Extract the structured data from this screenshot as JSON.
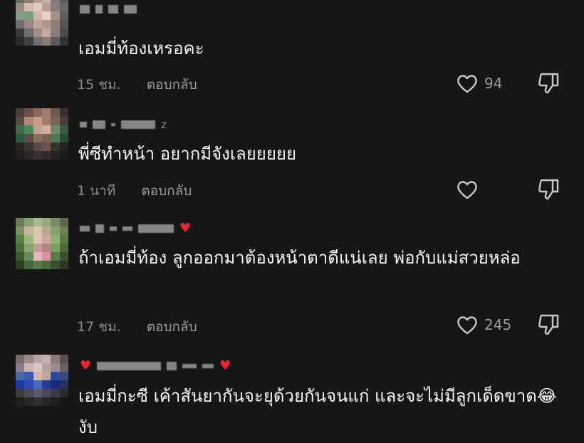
{
  "comments": [
    {
      "username_suffix": "",
      "text": "เอมมี่ท้องเหรอคะ",
      "time": "15 ชม.",
      "reply_label": "ตอบกลับ",
      "likes": "94",
      "avatar_colors": [
        "#6b6b6b",
        "#8a7a72",
        "#b49a94",
        "#c8b0a8",
        "#7b7b7b",
        "#5a5a5a",
        "#9c8a86",
        "#d4b8b0",
        "#e0c8c2",
        "#b89c96",
        "#8c7c78",
        "#6a6a6a",
        "#8a9a8a",
        "#7aa07a",
        "#d0b6ae",
        "#e8d0c8",
        "#a8908a",
        "#606060",
        "#707070",
        "#9a8680",
        "#c0a49c",
        "#b09890",
        "#8e7c78",
        "#565656",
        "#3a3a3a",
        "#6c6c6c",
        "#a08c88",
        "#c4aaa4",
        "#8a7c78",
        "#4a4a4a",
        "#2a2a2a",
        "#404040",
        "#707070",
        "#8a7a76",
        "#5c5c5c",
        "#333333"
      ]
    },
    {
      "username_suffix": "z",
      "text": "พี่ซีทำหน้า อยากมีจังเลยยยยย",
      "time": "1 นาที",
      "reply_label": "ตอบกลับ",
      "likes": "",
      "avatar_colors": [
        "#4a3c38",
        "#6a5048",
        "#8a6a5e",
        "#a07a6a",
        "#6a5a52",
        "#3a3030",
        "#5a4a44",
        "#b08a78",
        "#c89c88",
        "#a47c6c",
        "#7a6258",
        "#4a3e3a",
        "#3e6a4e",
        "#4a8a5c",
        "#c0a090",
        "#d4b09c",
        "#6a8a6c",
        "#3a5a44",
        "#2e5a3e",
        "#5a4c48",
        "#8a6c60",
        "#7a6054",
        "#4a7a56",
        "#2a4a34",
        "#2a2424",
        "#3e3432",
        "#5a4844",
        "#6a544c",
        "#3a3230",
        "#222222",
        "#1e1e1e",
        "#2c2626",
        "#3a3030",
        "#322a28",
        "#262222",
        "#1a1a1a"
      ]
    },
    {
      "username_suffix": "",
      "text": "ถ้าเอมมี่ท้อง ลูกออกมาต้องหน้าตาดีแน่เลย พ่อกับแม่สวยหล่อ",
      "time": "17 ชม.",
      "reply_label": "ตอบกลับ",
      "likes": "245",
      "avatar_colors": [
        "#6a7a5a",
        "#8aa070",
        "#a8b890",
        "#9aaa80",
        "#7a8a6a",
        "#5a6a4a",
        "#7a9060",
        "#c4b8a0",
        "#d8c8b0",
        "#b4a890",
        "#88a070",
        "#6a8050",
        "#5a8048",
        "#9ab880",
        "#e0c4b8",
        "#d0a8a0",
        "#90b078",
        "#5a7a44",
        "#4a7040",
        "#88a470",
        "#c09c94",
        "#b08880",
        "#7aa060",
        "#4a6a3a",
        "#3a5a30",
        "#6a8a58",
        "#e8b4c0",
        "#d890a4",
        "#5a7a48",
        "#3a5030",
        "#2a4024",
        "#4a6a3c",
        "#5a7a48",
        "#4a6a3c",
        "#3a5030",
        "#2a3a24"
      ]
    },
    {
      "username_suffix": "",
      "text": "เอมมี่กะซี เค้าสันยากันจะยุด้วยกันจนแก่ และจะไม่มีลูกเด็ดขาด😂งับ",
      "time": "",
      "reply_label": "",
      "likes": "",
      "avatar_colors": [
        "#7a6a6a",
        "#9a8a8a",
        "#b8a4a4",
        "#c4b0b0",
        "#8a7a7a",
        "#5a5050",
        "#8a7a8a",
        "#c8b4b0",
        "#d8c4c0",
        "#b8a0a0",
        "#9a8a8a",
        "#6a6060",
        "#4a6aa0",
        "#3a5ab0",
        "#d0b8b0",
        "#c0a8a0",
        "#2a4aa0",
        "#3a4a80",
        "#1a3aa0",
        "#2a4ab8",
        "#4a6ac0",
        "#2a3a90",
        "#1a2a80",
        "#2a3060",
        "#3a3a3a",
        "#4a4a5a",
        "#5a5a6a",
        "#4a4a5a",
        "#3a3a4a",
        "#2a2a2a",
        "#1e1e1e",
        "#262626",
        "#2e2e2e",
        "#262626",
        "#1e1e1e",
        "#161616"
      ]
    }
  ]
}
